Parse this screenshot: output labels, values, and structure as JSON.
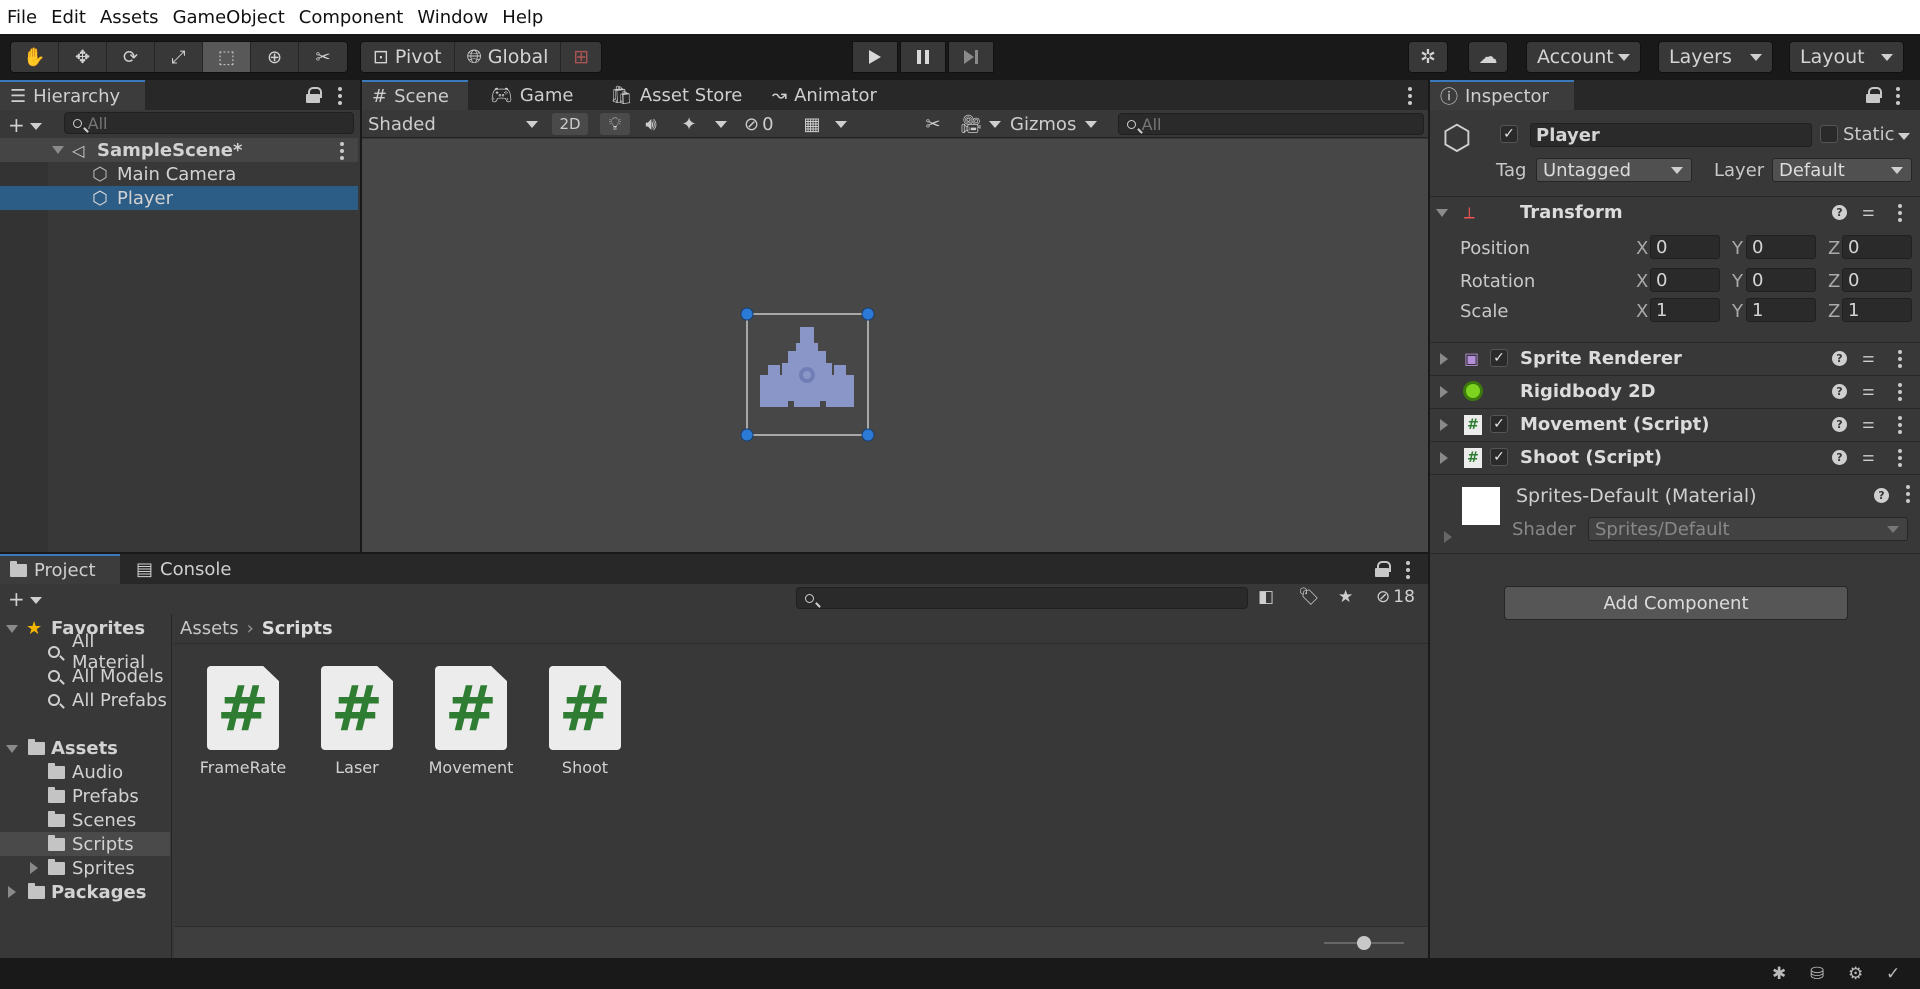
{
  "menu": [
    "File",
    "Edit",
    "Assets",
    "GameObject",
    "Component",
    "Window",
    "Help"
  ],
  "toolbar": {
    "tools": [
      "hand-tool",
      "move-tool",
      "rotate-tool",
      "scale-tool",
      "rect-tool",
      "transform-tool",
      "custom-tool"
    ],
    "pivot_label": "Pivot",
    "global_label": "Global",
    "account_label": "Account",
    "layers_label": "Layers",
    "layout_label": "Layout"
  },
  "hierarchy": {
    "tab_label": "Hierarchy",
    "search_placeholder": "All",
    "scene_name": "SampleScene*",
    "objects": [
      "Main Camera",
      "Player"
    ],
    "selected": "Player"
  },
  "scene_tabs": [
    "Scene",
    "Game",
    "Asset Store",
    "Animator"
  ],
  "scene_toolbar": {
    "shading_mode": "Shaded",
    "mode_2d": "2D",
    "hidden_count": "0",
    "gizmos_label": "Gizmos",
    "search_placeholder": "All"
  },
  "inspector": {
    "tab_label": "Inspector",
    "object_name": "Player",
    "static_label": "Static",
    "tag_label": "Tag",
    "tag_value": "Untagged",
    "layer_label": "Layer",
    "layer_value": "Default",
    "transform": {
      "title": "Transform",
      "position_label": "Position",
      "rotation_label": "Rotation",
      "scale_label": "Scale",
      "position": {
        "x": "0",
        "y": "0",
        "z": "0"
      },
      "rotation": {
        "x": "0",
        "y": "0",
        "z": "0"
      },
      "scale": {
        "x": "1",
        "y": "1",
        "z": "1"
      },
      "axis_x": "X",
      "axis_y": "Y",
      "axis_z": "Z"
    },
    "components": [
      "Sprite Renderer",
      "Rigidbody 2D",
      "Movement (Script)",
      "Shoot (Script)"
    ],
    "material": {
      "name": "Sprites-Default (Material)",
      "shader_label": "Shader",
      "shader_value": "Sprites/Default"
    },
    "add_component_label": "Add Component"
  },
  "project": {
    "tabs": [
      "Project",
      "Console"
    ],
    "hidden_count": "18",
    "favorites_label": "Favorites",
    "favorites": [
      "All Material",
      "All Models",
      "All Prefabs"
    ],
    "assets_label": "Assets",
    "asset_folders": [
      "Audio",
      "Prefabs",
      "Scenes",
      "Scripts",
      "Sprites"
    ],
    "packages_label": "Packages",
    "selected_folder": "Scripts",
    "breadcrumb": [
      "Assets",
      "Scripts"
    ],
    "files": [
      "FrameRate",
      "Laser",
      "Movement",
      "Shoot"
    ],
    "zoom_level": 0.5
  },
  "colors": {
    "selection": "#2c5d87",
    "accent": "#3a79bb",
    "script_green": "#2e7d32",
    "panel_bg": "#383838"
  }
}
